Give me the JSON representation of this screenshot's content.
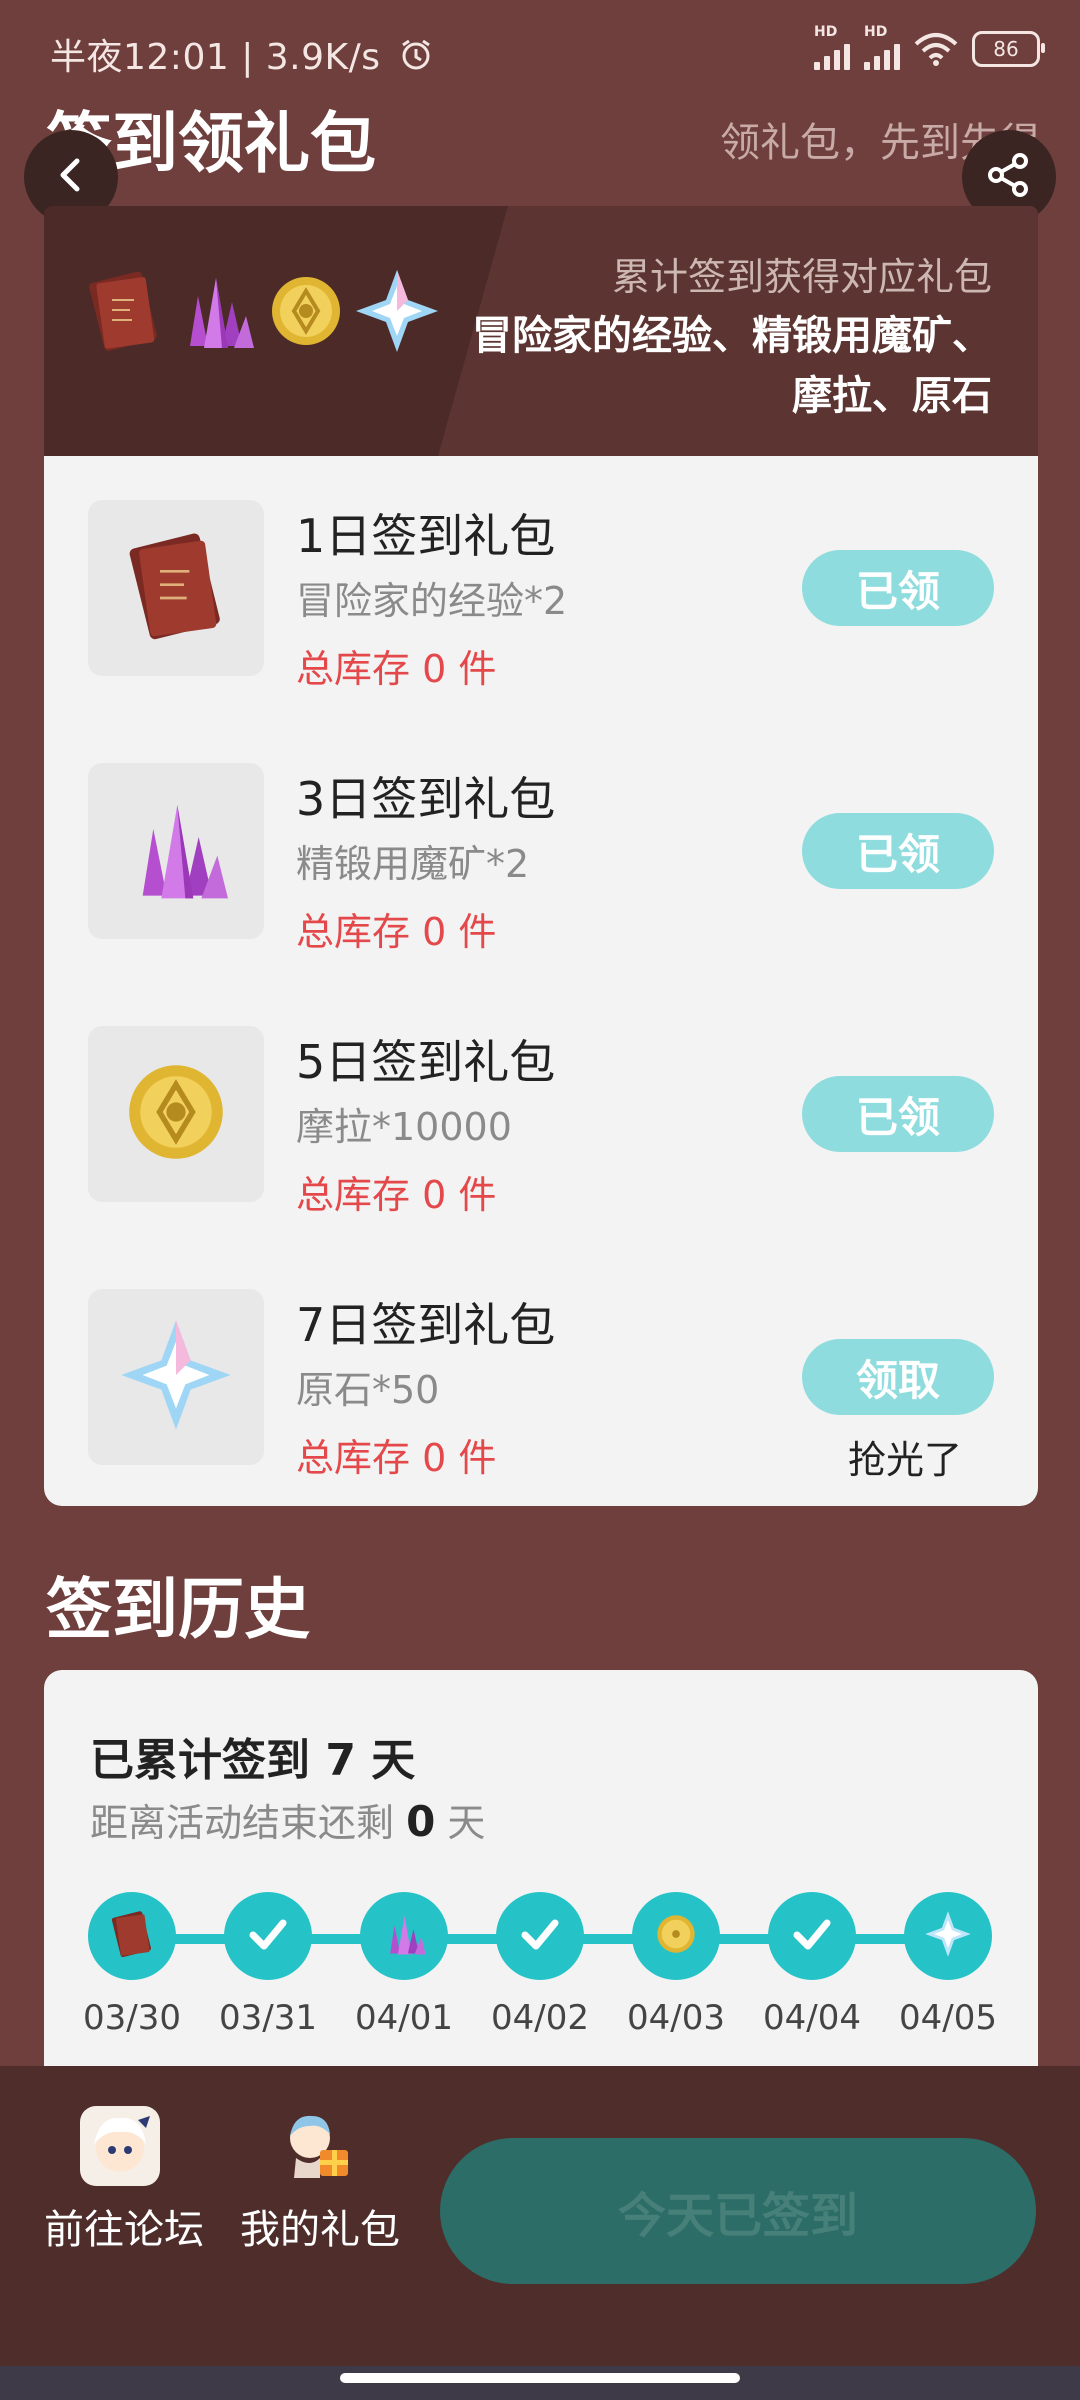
{
  "status_bar": {
    "time_speed": "半夜12:01 | 3.9K/s",
    "signal1_label": "HD",
    "signal2_label": "HD",
    "battery": "86",
    "alarm_icon": "alarm-icon",
    "wifi_icon": "wifi-icon"
  },
  "header": {
    "title": "签到领礼包",
    "subtitle": "领礼包，先到先得",
    "back_icon": "chevron-left-icon",
    "share_icon": "share-icon"
  },
  "banner": {
    "line1": "累计签到获得对应礼包",
    "line2": "冒险家的经验、精锻用魔矿、摩拉、原石",
    "icons": [
      "book-icon",
      "crystal-icon",
      "mora-coin-icon",
      "primogem-icon"
    ]
  },
  "gifts": [
    {
      "title": "1日签到礼包",
      "desc": "冒险家的经验*2",
      "stock": "总库存 0 件",
      "button": "已领",
      "icon": "book-icon"
    },
    {
      "title": "3日签到礼包",
      "desc": "精锻用魔矿*2",
      "stock": "总库存 0 件",
      "button": "已领",
      "icon": "crystal-icon"
    },
    {
      "title": "5日签到礼包",
      "desc": "摩拉*10000",
      "stock": "总库存 0 件",
      "button": "已领",
      "icon": "mora-coin-icon"
    },
    {
      "title": "7日签到礼包",
      "desc": "原石*50",
      "stock": "总库存 0 件",
      "button": "领取",
      "icon": "primogem-icon",
      "note": "抢光了"
    }
  ],
  "history": {
    "heading": "签到历史",
    "total_prefix": "已累计签到 ",
    "total_value": "7",
    "total_suffix": " 天",
    "remain_prefix": "距离活动结束还剩 ",
    "remain_value": "0",
    "remain_suffix": " 天",
    "days": [
      {
        "date": "03/30",
        "icon": "book-icon"
      },
      {
        "date": "03/31",
        "icon": "check-icon"
      },
      {
        "date": "04/01",
        "icon": "crystal-icon"
      },
      {
        "date": "04/02",
        "icon": "check-icon"
      },
      {
        "date": "04/03",
        "icon": "mora-coin-icon"
      },
      {
        "date": "04/04",
        "icon": "check-icon"
      },
      {
        "date": "04/05",
        "icon": "primogem-icon"
      }
    ]
  },
  "bottom_bar": {
    "forum_label": "前往论坛",
    "my_gifts_label": "我的礼包",
    "signed_button": "今天已签到",
    "forum_icon": "paimon-avatar-icon",
    "my_gifts_icon": "gift-avatar-icon"
  },
  "colors": {
    "page_bg": "#6e3f3c",
    "accent_teal": "#25c2c7",
    "claimed_button": "#8fdcdf",
    "stock_red": "#e4484a",
    "signed_button_bg": "#2c6d67"
  }
}
